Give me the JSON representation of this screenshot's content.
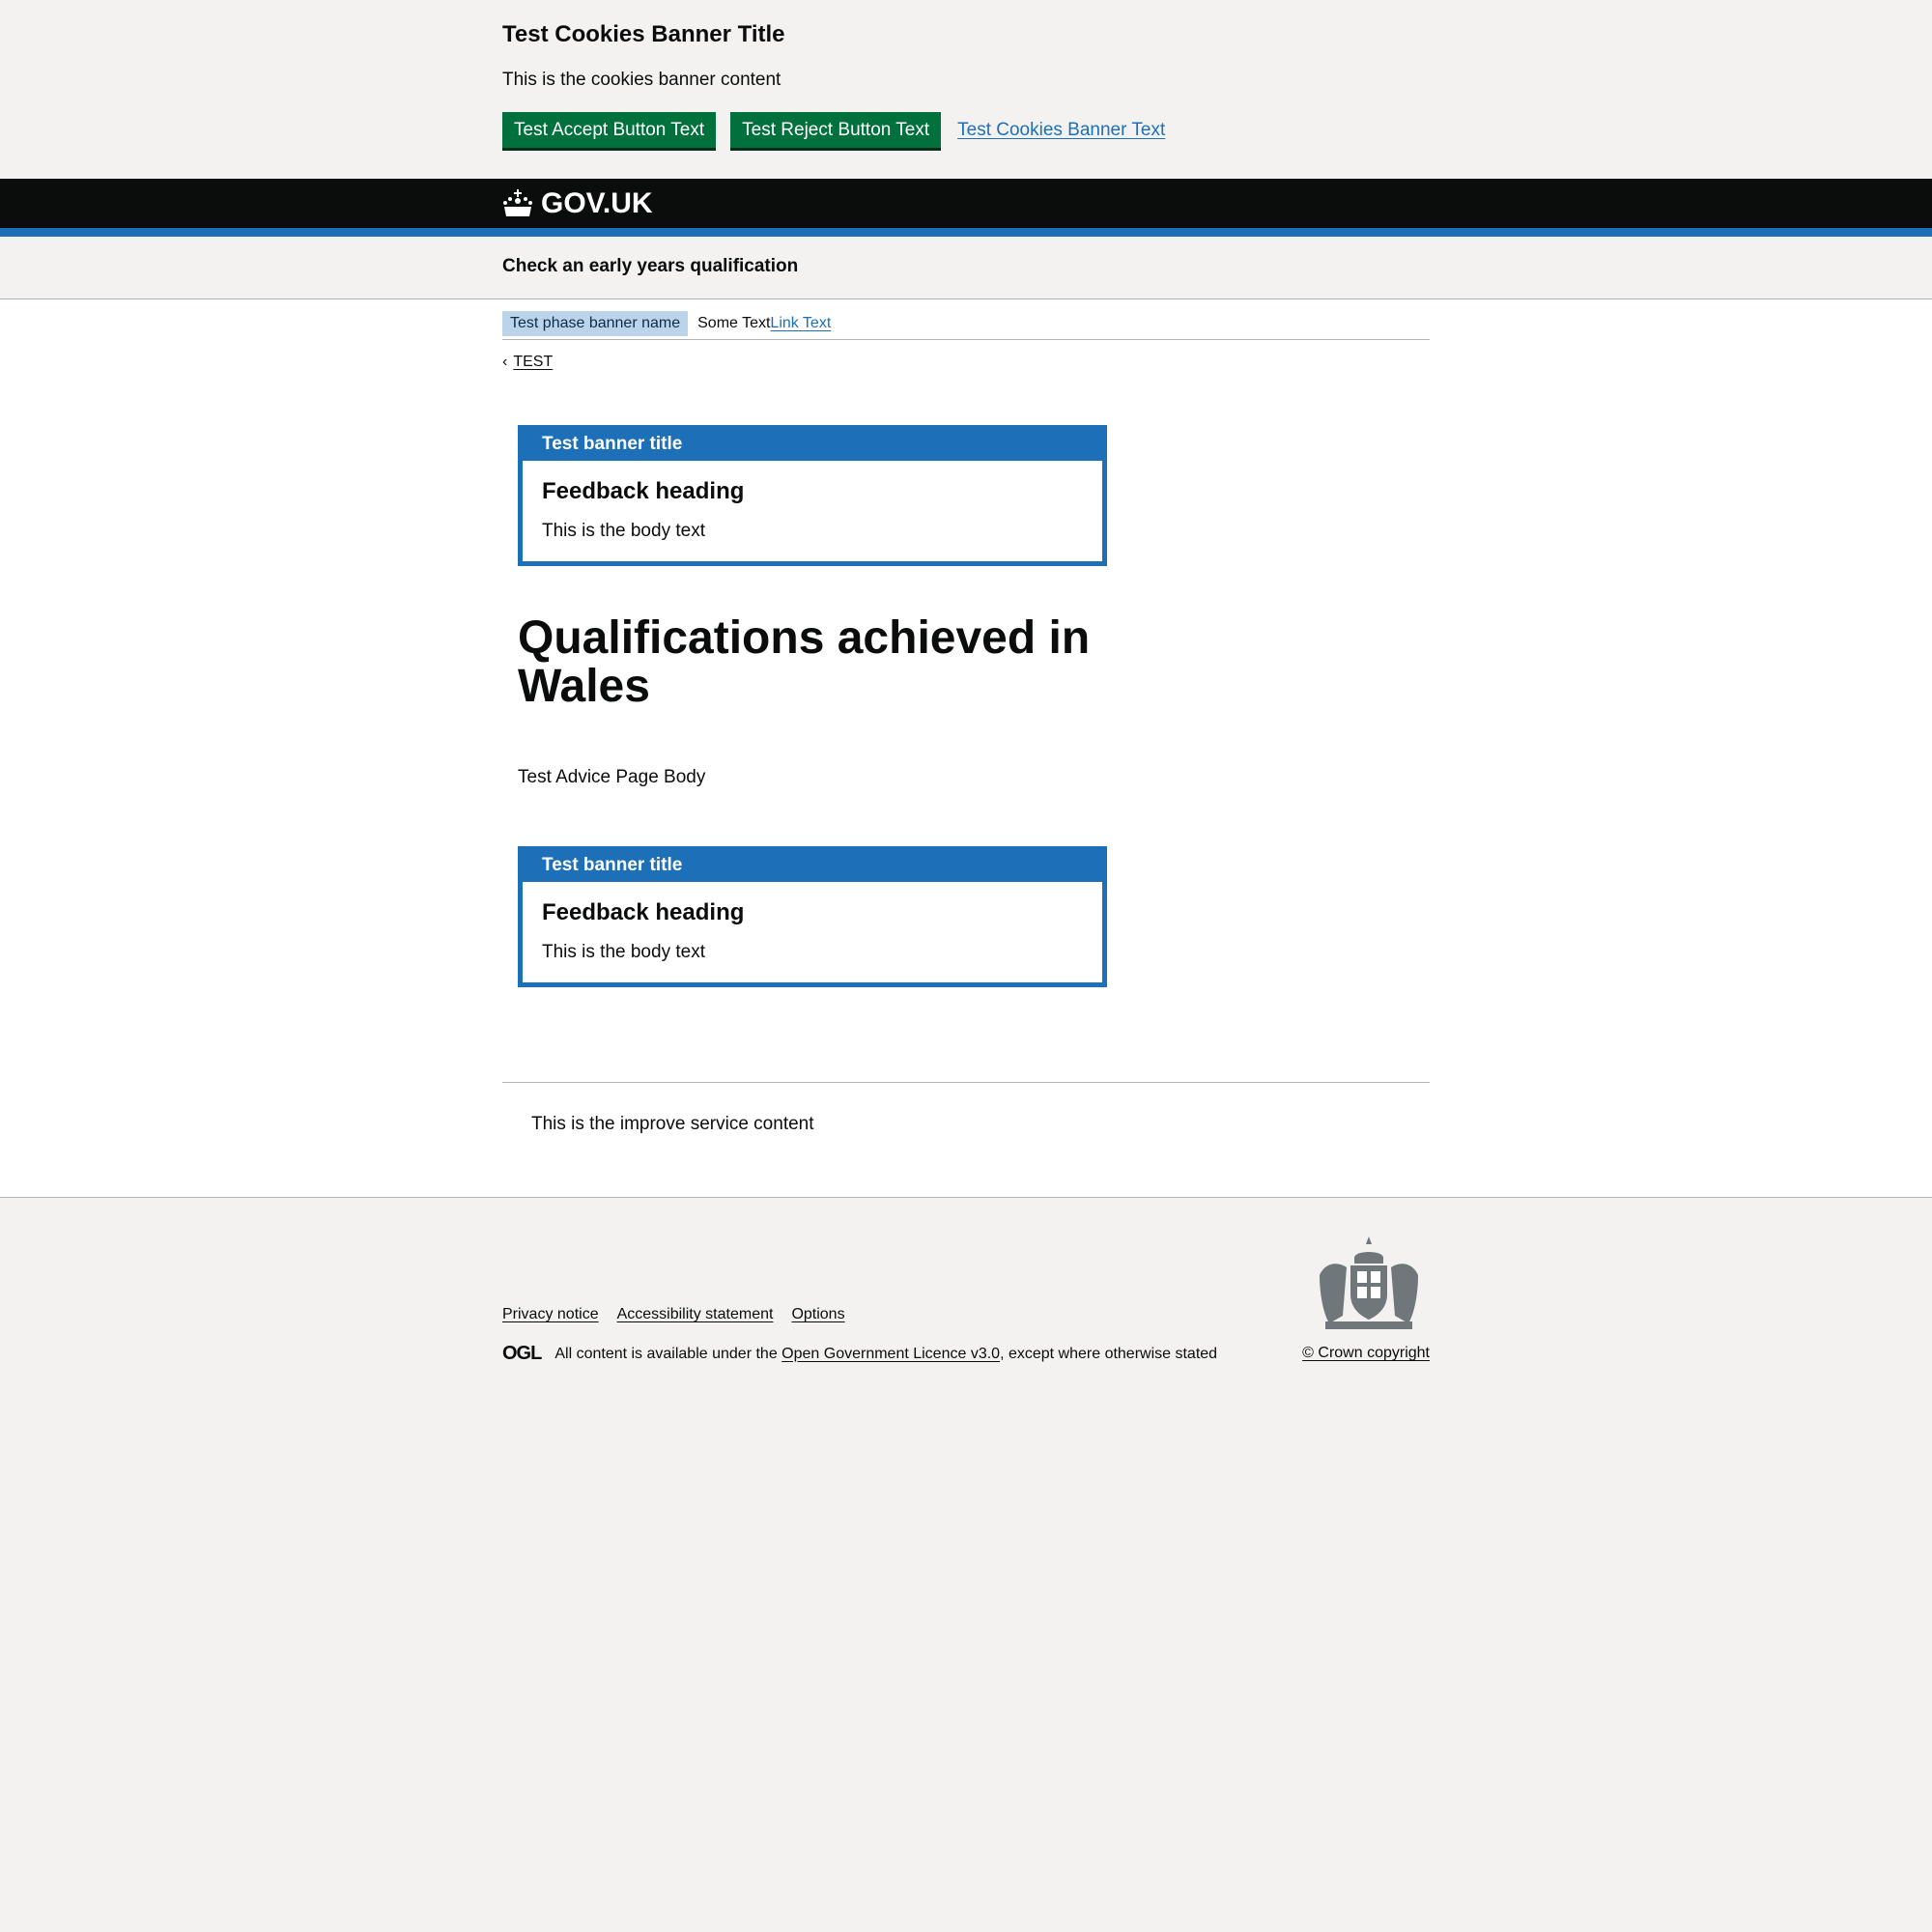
{
  "cookie_banner": {
    "title": "Test Cookies Banner Title",
    "content": "This is the cookies banner content",
    "accept_label": "Test Accept Button Text",
    "reject_label": "Test Reject Button Text",
    "link_text": "Test Cookies Banner Text"
  },
  "header": {
    "logo_text": "GOV.UK",
    "service_name": "Check an early years qualification"
  },
  "phase_banner": {
    "tag": "Test phase banner name",
    "text": "Some Text",
    "link": "Link Text"
  },
  "back_link": "TEST",
  "banners": [
    {
      "title": "Test banner title",
      "heading": "Feedback heading",
      "body": "This is the body text"
    },
    {
      "title": "Test banner title",
      "heading": "Feedback heading",
      "body": "This is the body text"
    }
  ],
  "main": {
    "heading": "Qualifications achieved in Wales",
    "body": "Test Advice Page Body",
    "improve": "This is the improve service content"
  },
  "footer": {
    "links": [
      "Privacy notice",
      "Accessibility statement",
      "Options"
    ],
    "ogl": "OGL",
    "licence_prefix": "All content is available under the ",
    "licence_link": "Open Government Licence v3.0",
    "licence_suffix": ", except where otherwise stated",
    "copyright": "© Crown copyright"
  },
  "colors": {
    "green": "#00703c",
    "blue": "#1d70b8",
    "black": "#0b0c0c",
    "grey": "#f3f2f1"
  }
}
